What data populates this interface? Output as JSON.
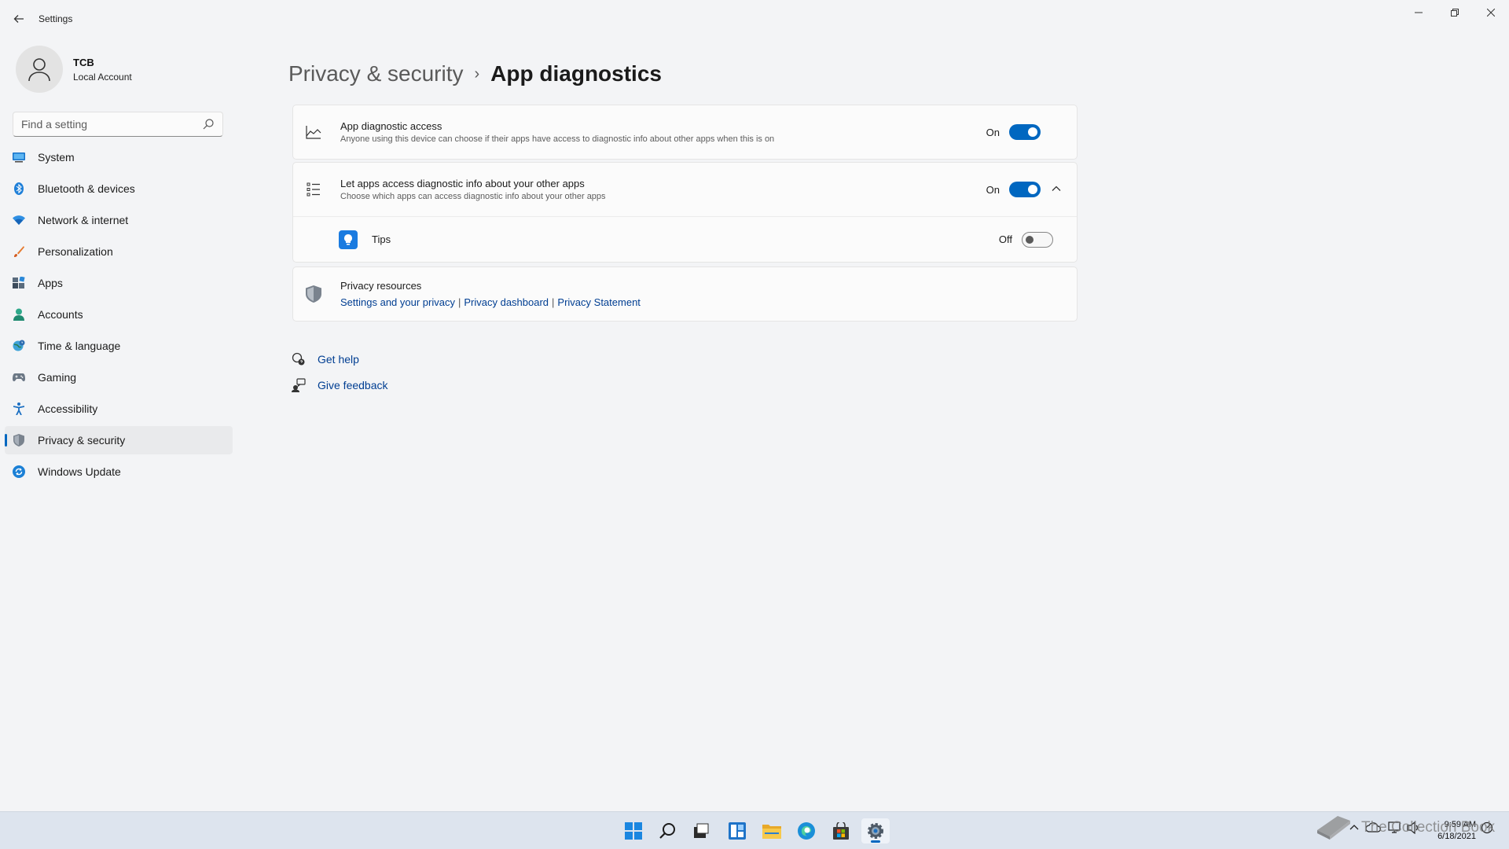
{
  "window": {
    "title": "Settings"
  },
  "profile": {
    "name": "TCB",
    "account_type": "Local Account"
  },
  "search": {
    "placeholder": "Find a setting"
  },
  "sidebar": {
    "items": [
      {
        "label": "System",
        "icon": "monitor-icon"
      },
      {
        "label": "Bluetooth & devices",
        "icon": "bluetooth-icon"
      },
      {
        "label": "Network & internet",
        "icon": "wifi-icon"
      },
      {
        "label": "Personalization",
        "icon": "brush-icon"
      },
      {
        "label": "Apps",
        "icon": "apps-icon"
      },
      {
        "label": "Accounts",
        "icon": "person-icon"
      },
      {
        "label": "Time & language",
        "icon": "globe-clock-icon"
      },
      {
        "label": "Gaming",
        "icon": "gamepad-icon"
      },
      {
        "label": "Accessibility",
        "icon": "accessibility-icon"
      },
      {
        "label": "Privacy & security",
        "icon": "shield-icon",
        "active": true
      },
      {
        "label": "Windows Update",
        "icon": "update-icon"
      }
    ]
  },
  "breadcrumb": {
    "parent": "Privacy & security",
    "separator": "›",
    "current": "App diagnostics"
  },
  "settings": {
    "diagnostic_access": {
      "title": "App diagnostic access",
      "description": "Anyone using this device can choose if their apps have access to diagnostic info about other apps when this is on",
      "state_label": "On",
      "enabled": true
    },
    "let_apps_access": {
      "title": "Let apps access diagnostic info about your other apps",
      "description": "Choose which apps can access diagnostic info about your other apps",
      "state_label": "On",
      "enabled": true,
      "expanded": true
    },
    "tips": {
      "title": "Tips",
      "state_label": "Off",
      "enabled": false
    }
  },
  "privacy_resources": {
    "title": "Privacy resources",
    "links": [
      "Settings and your privacy",
      "Privacy dashboard",
      "Privacy Statement"
    ],
    "separator": "|"
  },
  "help": {
    "get_help": "Get help",
    "give_feedback": "Give feedback"
  },
  "taskbar": {
    "apps": [
      "start-icon",
      "search-icon",
      "task-view-icon",
      "widgets-icon",
      "file-explorer-icon",
      "edge-icon",
      "store-icon",
      "settings-icon"
    ],
    "clock": {
      "time": "9:59 AM",
      "date": "6/18/2021"
    }
  },
  "watermark": "The Collection Book",
  "colors": {
    "accent": "#0067c0",
    "background": "#f3f4f6",
    "card": "#fbfbfb",
    "link": "#003e92"
  }
}
